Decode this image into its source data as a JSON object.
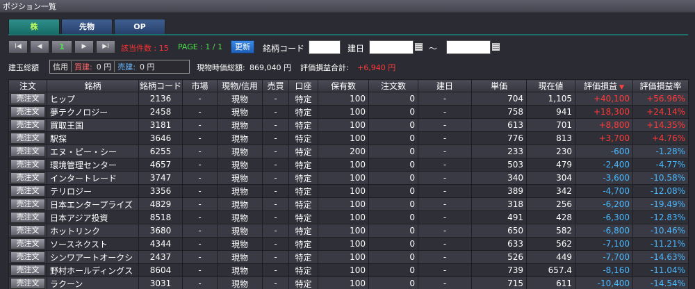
{
  "window": {
    "title": "ポジション一覧"
  },
  "tabs": [
    {
      "label": "株",
      "active": true
    },
    {
      "label": "先物",
      "active": false
    },
    {
      "label": "OP",
      "active": false
    }
  ],
  "toolbar": {
    "first": "I◀",
    "prev": "◀",
    "page_value": "1",
    "next": "▶",
    "last": "▶I",
    "count": "該当件数 : 15",
    "page_info": "PAGE : 1 / 1",
    "refresh_label": "更新",
    "code_label": "銘柄コード",
    "code_value": "",
    "date_label": "建日",
    "date_from": "",
    "tilde": "〜",
    "date_to": ""
  },
  "summary": {
    "total_label": "建玉総額",
    "margin_label": "信用",
    "buy_label": "買建:",
    "buy_value": "0 円",
    "sell_label": "売建:",
    "sell_value": "0 円",
    "market_label": "現物時価総額:",
    "market_value": "869,040 円",
    "pl_label": "評価損益合計:",
    "pl_value": "+6,940 円"
  },
  "colors": {
    "positive": "#ff3a3a",
    "negative": "#49b8ff",
    "count": "#ff3333",
    "page": "#4ee04e"
  },
  "table": {
    "columns": [
      "注文",
      "銘柄",
      "銘柄コード",
      "市場",
      "現物/信用",
      "売買",
      "口座",
      "保有数",
      "注文数",
      "建日",
      "単価",
      "現在値",
      "評価損益",
      "評価損益率"
    ],
    "sort_icon": "▼",
    "sell_button_label": "売注文",
    "rows": [
      {
        "name": "ヒップ",
        "code": "2136",
        "market": "-",
        "type": "現物",
        "side": "-",
        "account": "特定",
        "qty": "100",
        "order_qty": "0",
        "date": "-",
        "price": "704",
        "current": "1,105",
        "pl": "+40,100",
        "pl_rate": "+56.96%",
        "positive": true
      },
      {
        "name": "夢テクノロジー",
        "code": "2458",
        "market": "-",
        "type": "現物",
        "side": "-",
        "account": "特定",
        "qty": "100",
        "order_qty": "0",
        "date": "-",
        "price": "758",
        "current": "941",
        "pl": "+18,300",
        "pl_rate": "+24.14%",
        "positive": true
      },
      {
        "name": "買取王国",
        "code": "3181",
        "market": "-",
        "type": "現物",
        "side": "-",
        "account": "特定",
        "qty": "100",
        "order_qty": "0",
        "date": "-",
        "price": "613",
        "current": "701",
        "pl": "+8,800",
        "pl_rate": "+14.35%",
        "positive": true
      },
      {
        "name": "駅探",
        "code": "3646",
        "market": "-",
        "type": "現物",
        "side": "-",
        "account": "特定",
        "qty": "100",
        "order_qty": "0",
        "date": "-",
        "price": "776",
        "current": "813",
        "pl": "+3,700",
        "pl_rate": "+4.76%",
        "positive": true
      },
      {
        "name": "エヌ・ピー・シー",
        "code": "6255",
        "market": "-",
        "type": "現物",
        "side": "-",
        "account": "特定",
        "qty": "200",
        "order_qty": "0",
        "date": "-",
        "price": "233",
        "current": "230",
        "pl": "-600",
        "pl_rate": "-1.28%",
        "positive": false
      },
      {
        "name": "環境管理センター",
        "code": "4657",
        "market": "-",
        "type": "現物",
        "side": "-",
        "account": "特定",
        "qty": "100",
        "order_qty": "0",
        "date": "-",
        "price": "503",
        "current": "479",
        "pl": "-2,400",
        "pl_rate": "-4.77%",
        "positive": false
      },
      {
        "name": "インタートレード",
        "code": "3747",
        "market": "-",
        "type": "現物",
        "side": "-",
        "account": "特定",
        "qty": "100",
        "order_qty": "0",
        "date": "-",
        "price": "340",
        "current": "304",
        "pl": "-3,600",
        "pl_rate": "-10.58%",
        "positive": false
      },
      {
        "name": "テリロジー",
        "code": "3356",
        "market": "-",
        "type": "現物",
        "side": "-",
        "account": "特定",
        "qty": "100",
        "order_qty": "0",
        "date": "-",
        "price": "389",
        "current": "342",
        "pl": "-4,700",
        "pl_rate": "-12.08%",
        "positive": false
      },
      {
        "name": "日本エンタープライズ",
        "code": "4829",
        "market": "-",
        "type": "現物",
        "side": "-",
        "account": "特定",
        "qty": "100",
        "order_qty": "0",
        "date": "-",
        "price": "318",
        "current": "256",
        "pl": "-6,200",
        "pl_rate": "-19.49%",
        "positive": false
      },
      {
        "name": "日本アジア投資",
        "code": "8518",
        "market": "-",
        "type": "現物",
        "side": "-",
        "account": "特定",
        "qty": "100",
        "order_qty": "0",
        "date": "-",
        "price": "491",
        "current": "428",
        "pl": "-6,300",
        "pl_rate": "-12.83%",
        "positive": false
      },
      {
        "name": "ホットリンク",
        "code": "3680",
        "market": "-",
        "type": "現物",
        "side": "-",
        "account": "特定",
        "qty": "100",
        "order_qty": "0",
        "date": "-",
        "price": "650",
        "current": "582",
        "pl": "-6,800",
        "pl_rate": "-10.46%",
        "positive": false
      },
      {
        "name": "ソースネクスト",
        "code": "4344",
        "market": "-",
        "type": "現物",
        "side": "-",
        "account": "特定",
        "qty": "100",
        "order_qty": "0",
        "date": "-",
        "price": "633",
        "current": "562",
        "pl": "-7,100",
        "pl_rate": "-11.21%",
        "positive": false
      },
      {
        "name": "シンワアートオークシ",
        "code": "2437",
        "market": "-",
        "type": "現物",
        "side": "-",
        "account": "特定",
        "qty": "100",
        "order_qty": "0",
        "date": "-",
        "price": "526",
        "current": "449",
        "pl": "-7,700",
        "pl_rate": "-14.63%",
        "positive": false
      },
      {
        "name": "野村ホールディングス",
        "code": "8604",
        "market": "-",
        "type": "現物",
        "side": "-",
        "account": "特定",
        "qty": "100",
        "order_qty": "0",
        "date": "-",
        "price": "739",
        "current": "657.4",
        "pl": "-8,160",
        "pl_rate": "-11.04%",
        "positive": false
      },
      {
        "name": "ラクーン",
        "code": "3031",
        "market": "-",
        "type": "現物",
        "side": "-",
        "account": "特定",
        "qty": "100",
        "order_qty": "0",
        "date": "-",
        "price": "715",
        "current": "611",
        "pl": "-10,400",
        "pl_rate": "-14.54%",
        "positive": false
      }
    ]
  }
}
